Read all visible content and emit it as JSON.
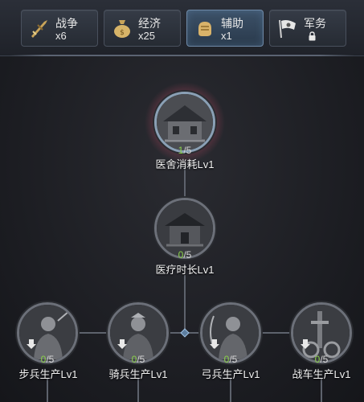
{
  "tabs": [
    {
      "label": "战争",
      "count": "x6",
      "icon": "sword-icon"
    },
    {
      "label": "经济",
      "count": "x25",
      "icon": "money-bag-icon"
    },
    {
      "label": "辅助",
      "count": "x1",
      "icon": "fist-icon",
      "active": true
    },
    {
      "label": "军务",
      "count": "",
      "icon": "flag-icon",
      "locked": true
    }
  ],
  "nodes": [
    {
      "name": "医舍消耗Lv1",
      "current": "1",
      "total": "/5",
      "icon": "building-icon"
    },
    {
      "name": "医疗时长Lv1",
      "current": "0",
      "total": "/5",
      "icon": "building-icon"
    },
    {
      "name": "步兵生产Lv1",
      "current": "0",
      "total": "/5",
      "icon": "infantry-icon"
    },
    {
      "name": "骑兵生产Lv1",
      "current": "0",
      "total": "/5",
      "icon": "cavalry-icon"
    },
    {
      "name": "弓兵生产Lv1",
      "current": "0",
      "total": "/5",
      "icon": "archer-icon"
    },
    {
      "name": "战车生产Lv1",
      "current": "0",
      "total": "/5",
      "icon": "chariot-icon"
    }
  ],
  "colors": {
    "progress_current": "#8ad04a",
    "active_tab": "#3c5168"
  }
}
